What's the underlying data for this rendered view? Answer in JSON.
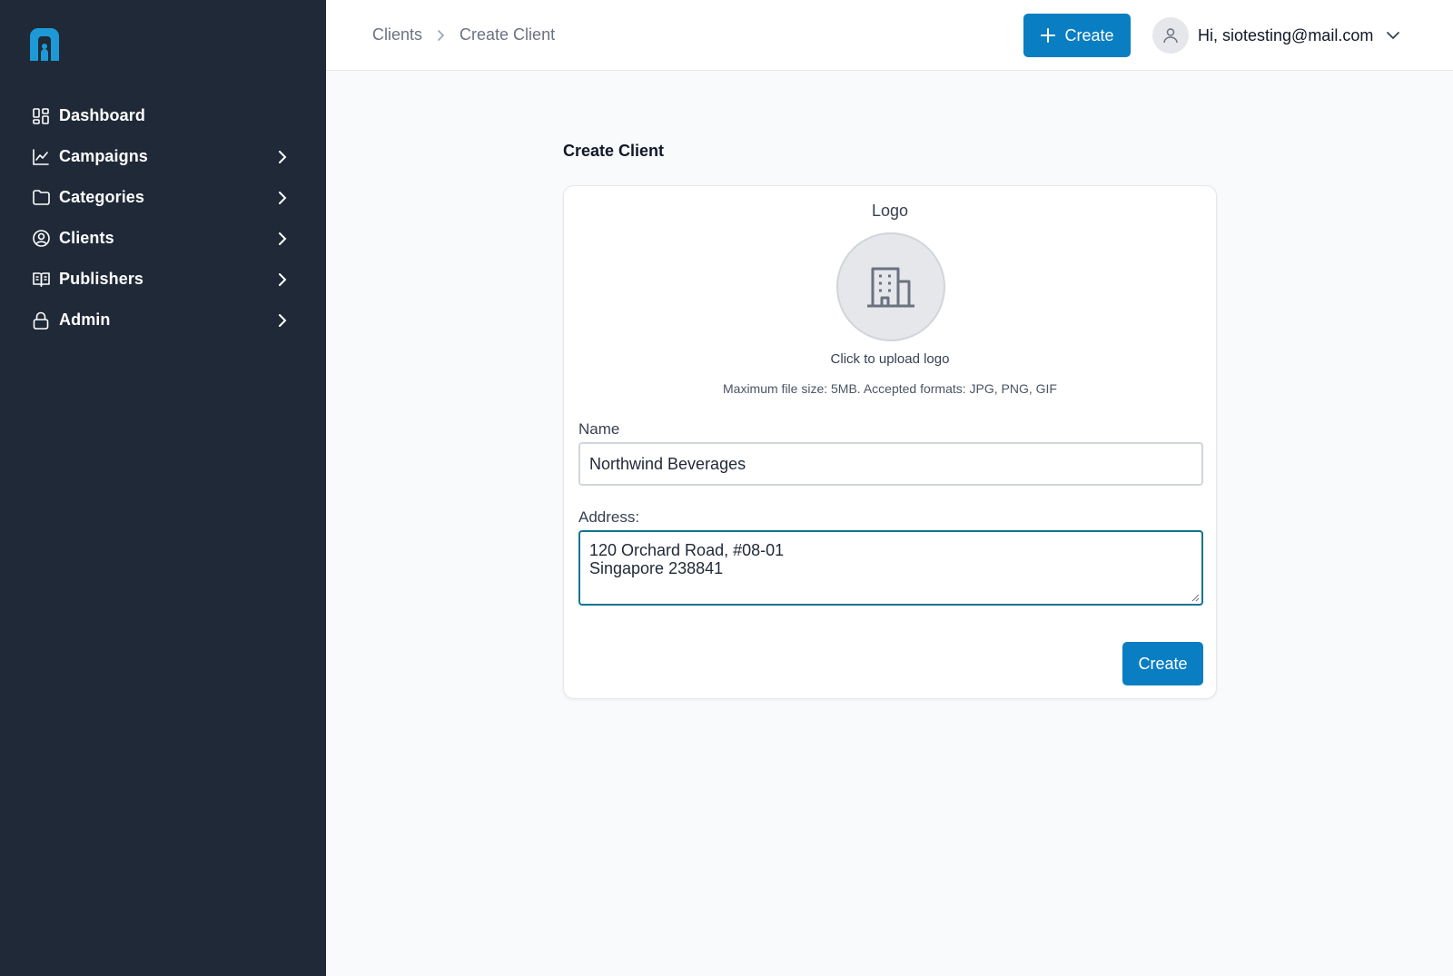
{
  "sidebar": {
    "items": [
      {
        "label": "Dashboard",
        "icon": "dashboard-icon"
      },
      {
        "label": "Campaigns",
        "icon": "chart-icon"
      },
      {
        "label": "Categories",
        "icon": "folder-icon"
      },
      {
        "label": "Clients",
        "icon": "user-circle-icon"
      },
      {
        "label": "Publishers",
        "icon": "book-icon"
      },
      {
        "label": "Admin",
        "icon": "lock-icon"
      }
    ]
  },
  "header": {
    "breadcrumb": [
      "Clients",
      "Create Client"
    ],
    "create_label": "Create",
    "user_greeting": "Hi, siotesting@mail.com"
  },
  "main": {
    "title": "Create Client",
    "logo_label": "Logo",
    "upload_text": "Click to upload logo",
    "upload_hint": "Maximum file size: 5MB. Accepted formats: JPG, PNG, GIF",
    "name_label": "Name",
    "name_value": "Northwind Beverages",
    "address_label": "Address:",
    "address_value": "120 Orchard Road, #08-01\nSingapore 238841",
    "submit_label": "Create"
  },
  "colors": {
    "sidebar_bg": "#1f2937",
    "primary": "#0a7ec2",
    "brand_logo": "#1d9ad6",
    "focus_border": "#0e7490"
  }
}
